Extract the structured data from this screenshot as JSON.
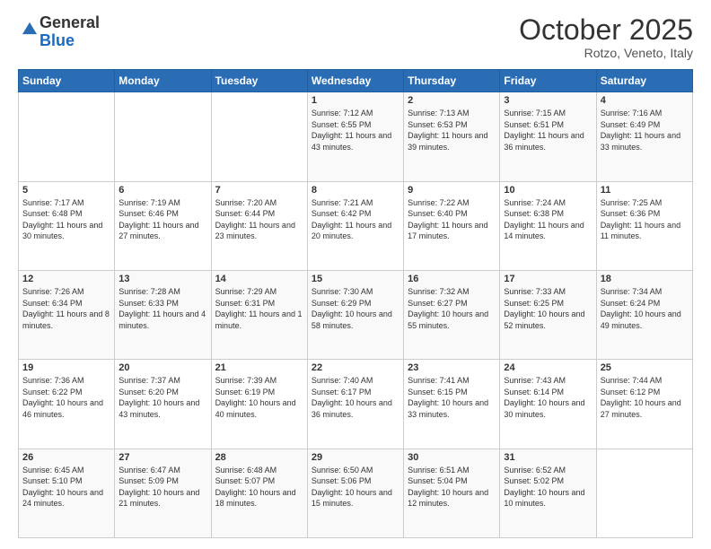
{
  "header": {
    "logo_general": "General",
    "logo_blue": "Blue",
    "month_title": "October 2025",
    "location": "Rotzo, Veneto, Italy"
  },
  "days_of_week": [
    "Sunday",
    "Monday",
    "Tuesday",
    "Wednesday",
    "Thursday",
    "Friday",
    "Saturday"
  ],
  "weeks": [
    [
      {
        "day": "",
        "sunrise": "",
        "sunset": "",
        "daylight": ""
      },
      {
        "day": "",
        "sunrise": "",
        "sunset": "",
        "daylight": ""
      },
      {
        "day": "",
        "sunrise": "",
        "sunset": "",
        "daylight": ""
      },
      {
        "day": "1",
        "sunrise": "Sunrise: 7:12 AM",
        "sunset": "Sunset: 6:55 PM",
        "daylight": "Daylight: 11 hours and 43 minutes."
      },
      {
        "day": "2",
        "sunrise": "Sunrise: 7:13 AM",
        "sunset": "Sunset: 6:53 PM",
        "daylight": "Daylight: 11 hours and 39 minutes."
      },
      {
        "day": "3",
        "sunrise": "Sunrise: 7:15 AM",
        "sunset": "Sunset: 6:51 PM",
        "daylight": "Daylight: 11 hours and 36 minutes."
      },
      {
        "day": "4",
        "sunrise": "Sunrise: 7:16 AM",
        "sunset": "Sunset: 6:49 PM",
        "daylight": "Daylight: 11 hours and 33 minutes."
      }
    ],
    [
      {
        "day": "5",
        "sunrise": "Sunrise: 7:17 AM",
        "sunset": "Sunset: 6:48 PM",
        "daylight": "Daylight: 11 hours and 30 minutes."
      },
      {
        "day": "6",
        "sunrise": "Sunrise: 7:19 AM",
        "sunset": "Sunset: 6:46 PM",
        "daylight": "Daylight: 11 hours and 27 minutes."
      },
      {
        "day": "7",
        "sunrise": "Sunrise: 7:20 AM",
        "sunset": "Sunset: 6:44 PM",
        "daylight": "Daylight: 11 hours and 23 minutes."
      },
      {
        "day": "8",
        "sunrise": "Sunrise: 7:21 AM",
        "sunset": "Sunset: 6:42 PM",
        "daylight": "Daylight: 11 hours and 20 minutes."
      },
      {
        "day": "9",
        "sunrise": "Sunrise: 7:22 AM",
        "sunset": "Sunset: 6:40 PM",
        "daylight": "Daylight: 11 hours and 17 minutes."
      },
      {
        "day": "10",
        "sunrise": "Sunrise: 7:24 AM",
        "sunset": "Sunset: 6:38 PM",
        "daylight": "Daylight: 11 hours and 14 minutes."
      },
      {
        "day": "11",
        "sunrise": "Sunrise: 7:25 AM",
        "sunset": "Sunset: 6:36 PM",
        "daylight": "Daylight: 11 hours and 11 minutes."
      }
    ],
    [
      {
        "day": "12",
        "sunrise": "Sunrise: 7:26 AM",
        "sunset": "Sunset: 6:34 PM",
        "daylight": "Daylight: 11 hours and 8 minutes."
      },
      {
        "day": "13",
        "sunrise": "Sunrise: 7:28 AM",
        "sunset": "Sunset: 6:33 PM",
        "daylight": "Daylight: 11 hours and 4 minutes."
      },
      {
        "day": "14",
        "sunrise": "Sunrise: 7:29 AM",
        "sunset": "Sunset: 6:31 PM",
        "daylight": "Daylight: 11 hours and 1 minute."
      },
      {
        "day": "15",
        "sunrise": "Sunrise: 7:30 AM",
        "sunset": "Sunset: 6:29 PM",
        "daylight": "Daylight: 10 hours and 58 minutes."
      },
      {
        "day": "16",
        "sunrise": "Sunrise: 7:32 AM",
        "sunset": "Sunset: 6:27 PM",
        "daylight": "Daylight: 10 hours and 55 minutes."
      },
      {
        "day": "17",
        "sunrise": "Sunrise: 7:33 AM",
        "sunset": "Sunset: 6:25 PM",
        "daylight": "Daylight: 10 hours and 52 minutes."
      },
      {
        "day": "18",
        "sunrise": "Sunrise: 7:34 AM",
        "sunset": "Sunset: 6:24 PM",
        "daylight": "Daylight: 10 hours and 49 minutes."
      }
    ],
    [
      {
        "day": "19",
        "sunrise": "Sunrise: 7:36 AM",
        "sunset": "Sunset: 6:22 PM",
        "daylight": "Daylight: 10 hours and 46 minutes."
      },
      {
        "day": "20",
        "sunrise": "Sunrise: 7:37 AM",
        "sunset": "Sunset: 6:20 PM",
        "daylight": "Daylight: 10 hours and 43 minutes."
      },
      {
        "day": "21",
        "sunrise": "Sunrise: 7:39 AM",
        "sunset": "Sunset: 6:19 PM",
        "daylight": "Daylight: 10 hours and 40 minutes."
      },
      {
        "day": "22",
        "sunrise": "Sunrise: 7:40 AM",
        "sunset": "Sunset: 6:17 PM",
        "daylight": "Daylight: 10 hours and 36 minutes."
      },
      {
        "day": "23",
        "sunrise": "Sunrise: 7:41 AM",
        "sunset": "Sunset: 6:15 PM",
        "daylight": "Daylight: 10 hours and 33 minutes."
      },
      {
        "day": "24",
        "sunrise": "Sunrise: 7:43 AM",
        "sunset": "Sunset: 6:14 PM",
        "daylight": "Daylight: 10 hours and 30 minutes."
      },
      {
        "day": "25",
        "sunrise": "Sunrise: 7:44 AM",
        "sunset": "Sunset: 6:12 PM",
        "daylight": "Daylight: 10 hours and 27 minutes."
      }
    ],
    [
      {
        "day": "26",
        "sunrise": "Sunrise: 6:45 AM",
        "sunset": "Sunset: 5:10 PM",
        "daylight": "Daylight: 10 hours and 24 minutes."
      },
      {
        "day": "27",
        "sunrise": "Sunrise: 6:47 AM",
        "sunset": "Sunset: 5:09 PM",
        "daylight": "Daylight: 10 hours and 21 minutes."
      },
      {
        "day": "28",
        "sunrise": "Sunrise: 6:48 AM",
        "sunset": "Sunset: 5:07 PM",
        "daylight": "Daylight: 10 hours and 18 minutes."
      },
      {
        "day": "29",
        "sunrise": "Sunrise: 6:50 AM",
        "sunset": "Sunset: 5:06 PM",
        "daylight": "Daylight: 10 hours and 15 minutes."
      },
      {
        "day": "30",
        "sunrise": "Sunrise: 6:51 AM",
        "sunset": "Sunset: 5:04 PM",
        "daylight": "Daylight: 10 hours and 12 minutes."
      },
      {
        "day": "31",
        "sunrise": "Sunrise: 6:52 AM",
        "sunset": "Sunset: 5:02 PM",
        "daylight": "Daylight: 10 hours and 10 minutes."
      },
      {
        "day": "",
        "sunrise": "",
        "sunset": "",
        "daylight": ""
      }
    ]
  ]
}
